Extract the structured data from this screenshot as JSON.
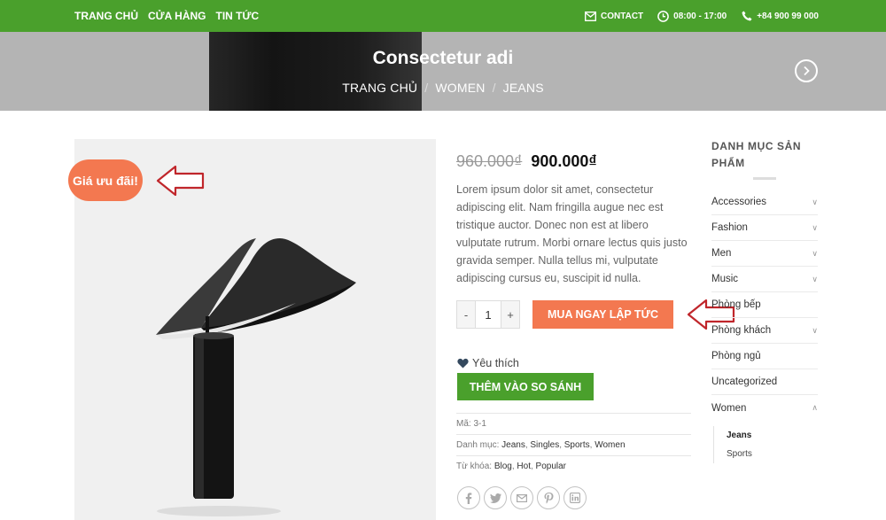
{
  "topbar": {
    "nav": [
      "TRANG CHỦ",
      "CỬA HÀNG",
      "TIN TỨC"
    ],
    "contact": "CONTACT",
    "hours": "08:00 - 17:00",
    "phone": "+84 900 99 000"
  },
  "hero": {
    "title": "Consectetur adi",
    "breadcrumb": [
      "TRANG CHỦ",
      "WOMEN",
      "JEANS"
    ]
  },
  "product": {
    "sale_badge": "Giá ưu đãi!",
    "old_price": "960.000₫",
    "new_price": "900.000₫",
    "description": "Lorem ipsum dolor sit amet, consectetur adipiscing elit. Nam fringilla augue nec est tristique auctor. Donec non est at libero vulputate rutrum. Morbi ornare lectus quis justo gravida semper. Nulla tellus mi, vulputate adipiscing cursus eu, suscipit id nulla.",
    "quantity": "1",
    "qty_minus": "-",
    "qty_plus": "+",
    "buy_button": "MUA NGAY LẬP TỨC",
    "wishlist": "Yêu thích",
    "compare_button": "THÊM VÀO SO SÁNH",
    "sku_label": "Mã:",
    "sku": "3-1",
    "categories_label": "Danh mục:",
    "categories": [
      "Jeans",
      "Singles",
      "Sports",
      "Women"
    ],
    "tags_label": "Từ khóa:",
    "tags": [
      "Blog",
      "Hot",
      "Popular"
    ]
  },
  "sidebar": {
    "title": "DANH MỤC SẢN PHẨM",
    "items": [
      {
        "label": "Accessories",
        "expandable": true
      },
      {
        "label": "Fashion",
        "expandable": true
      },
      {
        "label": "Men",
        "expandable": true
      },
      {
        "label": "Music",
        "expandable": true
      },
      {
        "label": "Phòng bếp",
        "expandable": false
      },
      {
        "label": "Phòng khách",
        "expandable": true
      },
      {
        "label": "Phòng ngủ",
        "expandable": false
      },
      {
        "label": "Uncategorized",
        "expandable": false
      },
      {
        "label": "Women",
        "expandable": true,
        "open": true
      }
    ],
    "sub_items": [
      "Jeans",
      "Sports"
    ]
  },
  "colors": {
    "brand_green": "#4aa02c",
    "accent_orange": "#f37850",
    "annotation_red": "#c0262b"
  }
}
